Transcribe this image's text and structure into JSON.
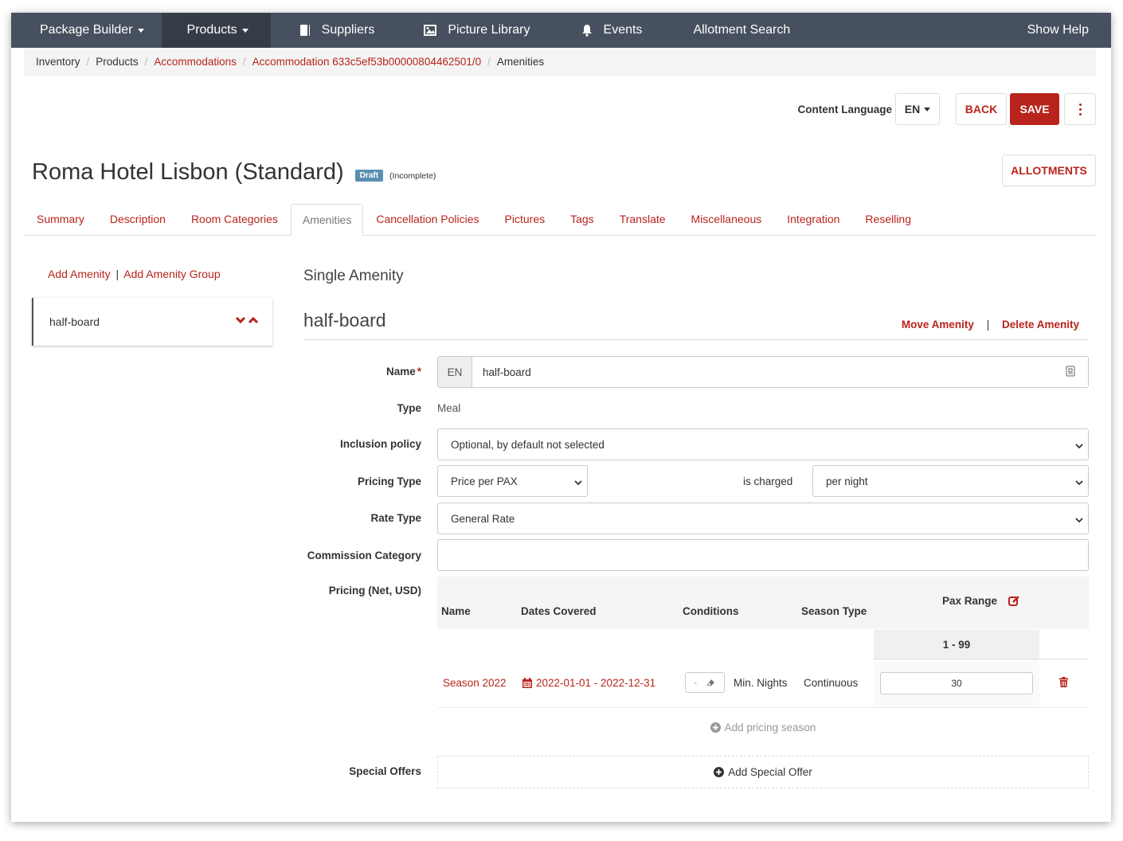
{
  "nav": {
    "package_builder": "Package Builder",
    "products": "Products",
    "suppliers": "Suppliers",
    "picture_library": "Picture Library",
    "events": "Events",
    "allotment_search": "Allotment Search",
    "show_help": "Show Help"
  },
  "breadcrumb": {
    "inventory": "Inventory",
    "products": "Products",
    "accommodations": "Accommodations",
    "accommodation": "Accommodation 633c5ef53b00000804462501/0",
    "amenities": "Amenities"
  },
  "toolbar": {
    "content_language_label": "Content Language",
    "language": "EN",
    "back": "BACK",
    "save": "SAVE",
    "allotments": "ALLOTMENTS"
  },
  "header": {
    "title": "Roma Hotel Lisbon (Standard)",
    "status_badge": "Draft",
    "completeness": "(Incomplete)"
  },
  "tabs": [
    "Summary",
    "Description",
    "Room Categories",
    "Amenities",
    "Cancellation Policies",
    "Pictures",
    "Tags",
    "Translate",
    "Miscellaneous",
    "Integration",
    "Reselling"
  ],
  "active_tab": "Amenities",
  "left": {
    "add_amenity": "Add Amenity",
    "separator": "|",
    "add_amenity_group": "Add Amenity Group",
    "items": [
      {
        "label": "half-board"
      }
    ]
  },
  "main": {
    "section_title": "Single Amenity",
    "amenity_name": "half-board",
    "move_amenity": "Move Amenity",
    "divider": "|",
    "delete_amenity": "Delete Amenity"
  },
  "form": {
    "name_label": "Name",
    "required_mark": "*",
    "name_lang": "EN",
    "name_value": "half-board",
    "type_label": "Type",
    "type_value": "Meal",
    "inclusion_label": "Inclusion policy",
    "inclusion_value": "Optional, by default not selected",
    "pricing_type_label": "Pricing Type",
    "pricing_type_value": "Price per PAX",
    "is_charged": "is charged",
    "charge_value": "per night",
    "rate_type_label": "Rate Type",
    "rate_type_value": "General Rate",
    "commission_label": "Commission Category",
    "commission_value": "",
    "pricing_label": "Pricing (Net, USD)",
    "special_offers_label": "Special Offers"
  },
  "pricing": {
    "headers": {
      "name": "Name",
      "dates": "Dates Covered",
      "conditions": "Conditions",
      "season_type": "Season Type",
      "pax_range": "Pax Range"
    },
    "range": "1 - 99",
    "rows": [
      {
        "name": "Season 2022",
        "dates": "2022-01-01 - 2022-12-31",
        "condition_value": "-",
        "condition_label": "Min. Nights",
        "season_type": "Continuous",
        "price": "30"
      }
    ],
    "add_season": "Add pricing season",
    "add_offer": "Add Special Offer"
  },
  "colors": {
    "accent": "#b8241c",
    "nav_bg": "#47505e",
    "nav_active": "#363c47",
    "badge": "#5b8fb0"
  }
}
